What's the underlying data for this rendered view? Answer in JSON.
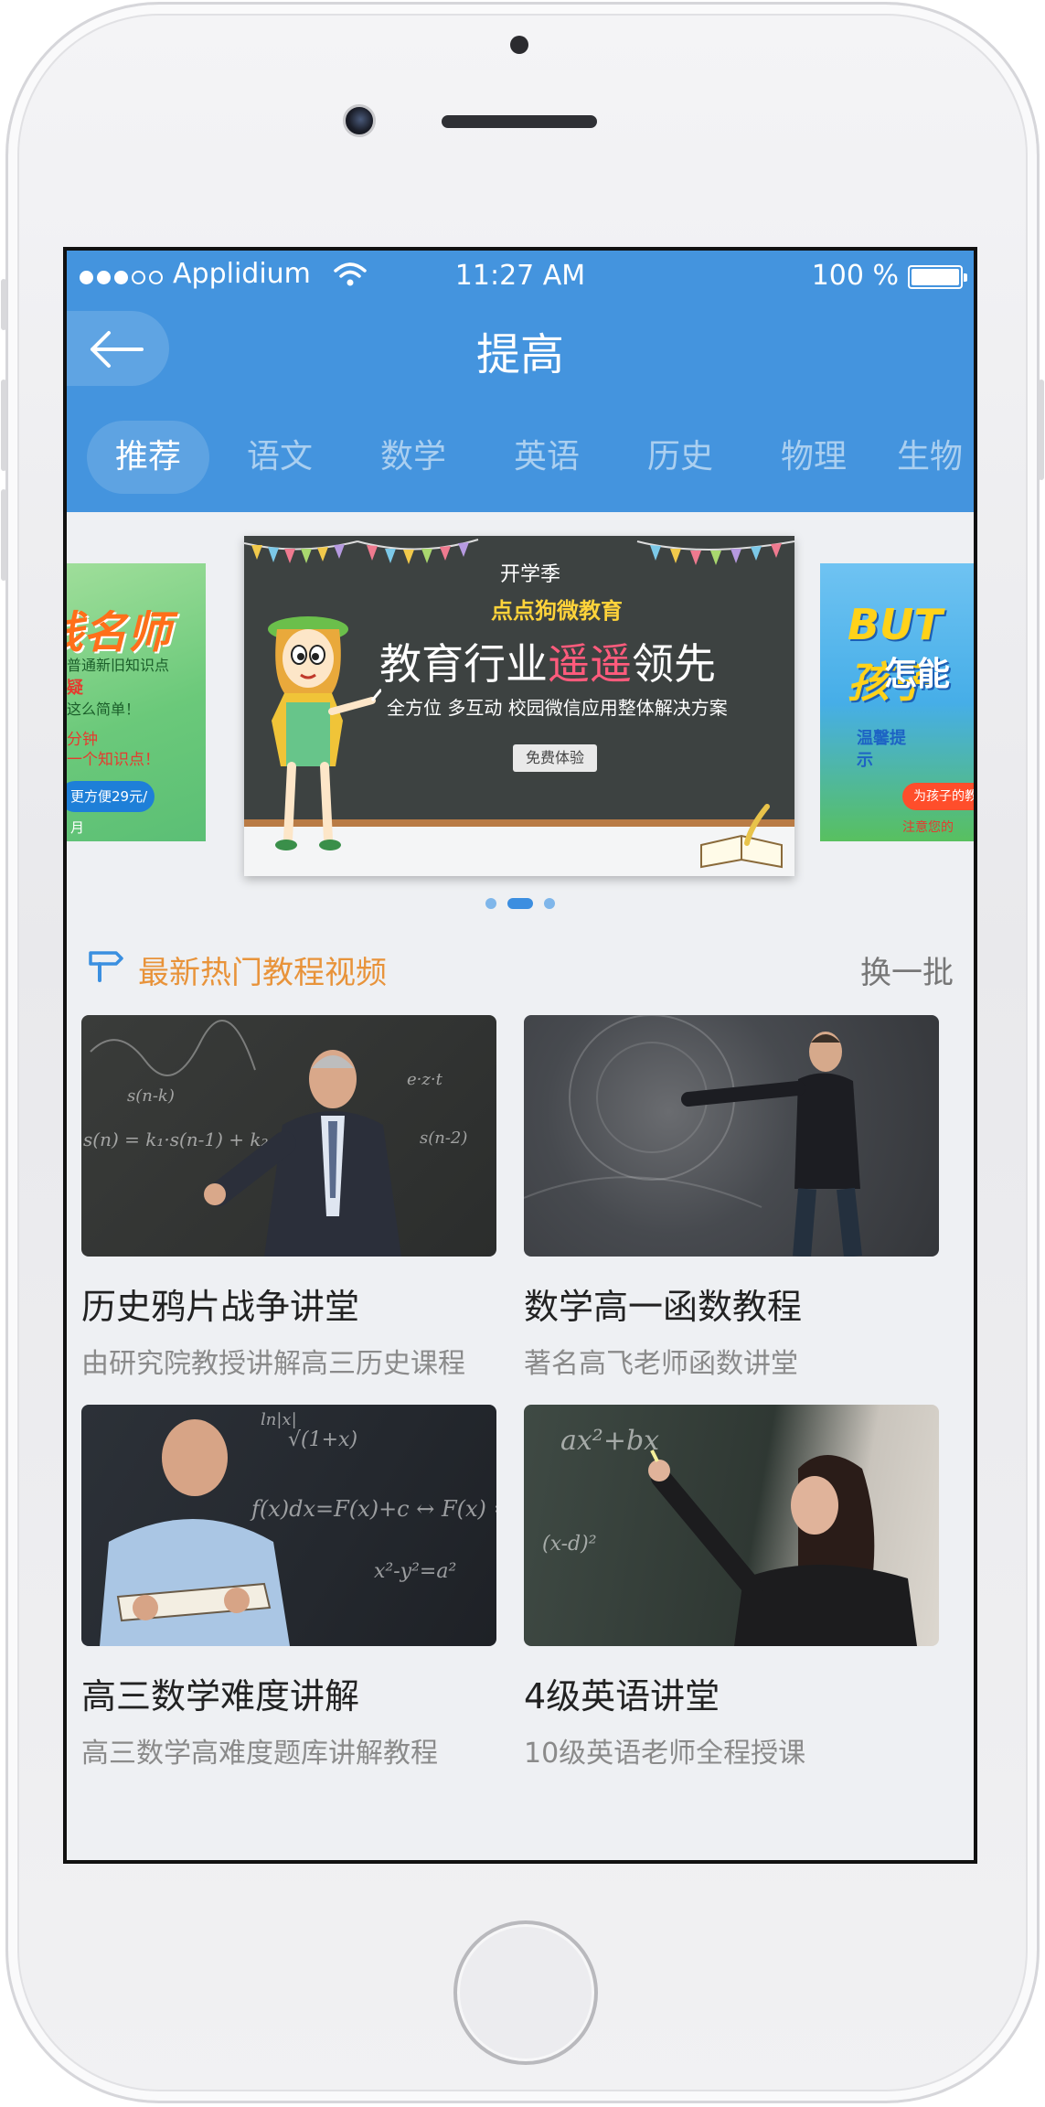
{
  "status_bar": {
    "carrier": "Applidium",
    "time": "11:27 AM",
    "battery": "100 %"
  },
  "nav": {
    "title": "提高",
    "back_icon": "arrow-left-icon"
  },
  "tabs": [
    {
      "label": "推荐",
      "active": true
    },
    {
      "label": "语文",
      "active": false
    },
    {
      "label": "数学",
      "active": false
    },
    {
      "label": "英语",
      "active": false
    },
    {
      "label": "历史",
      "active": false
    },
    {
      "label": "物理",
      "active": false
    },
    {
      "label": "生物",
      "active": false
    }
  ],
  "banner": {
    "left": {
      "title": "线名师",
      "lines": [
        "普通新旧知识点",
        "疑",
        "这么简单！",
        "分钟",
        "一个知识点！"
      ],
      "pill": "更方便29元/月"
    },
    "main": {
      "season": "开学季",
      "brand": "点点狗微教育",
      "headline_pre": "教育行业",
      "headline_accent": "遥遥",
      "headline_post": "领先",
      "tagline": "全方位  多互动  校园微信应用整体解决方案",
      "cta": "免费体验"
    },
    "right": {
      "title": "BUT孩子",
      "title2": "怎能",
      "tip": "温馨提示",
      "pill": "为孩子的教",
      "foot": "注意您的"
    },
    "page_count": 3,
    "active_page": 1
  },
  "section": {
    "title": "最新热门教程视频",
    "action": "换一批",
    "icon": "signpost-icon",
    "accent_color": "#e8933a"
  },
  "videos": [
    {
      "title": "历史鸦片战争讲堂",
      "desc": "由研究院教授讲解高三历史课程",
      "thumb_text": [
        "s(n-k)",
        "s(n) = k₁·s(n-1) + k₂",
        "s(n-2)",
        "e·z·t"
      ]
    },
    {
      "title": "数学高一函数教程",
      "desc": "著名高飞老师函数讲堂",
      "thumb_text": []
    },
    {
      "title": "高三数学难度讲解",
      "desc": "高三数学高难度题库讲解教程",
      "thumb_text": [
        "√(1+x)",
        "f(x)dx=F(x)+c ↔ F(x) = ∫f(x)",
        "x²-y²=a²",
        "ln|x|"
      ]
    },
    {
      "title": "4级英语讲堂",
      "desc": "10级英语老师全程授课",
      "thumb_text": [
        "ax²+bx",
        "(x-d)²"
      ]
    }
  ],
  "colors": {
    "header_blue": "#4494de",
    "page_bg": "#eef0f3"
  }
}
